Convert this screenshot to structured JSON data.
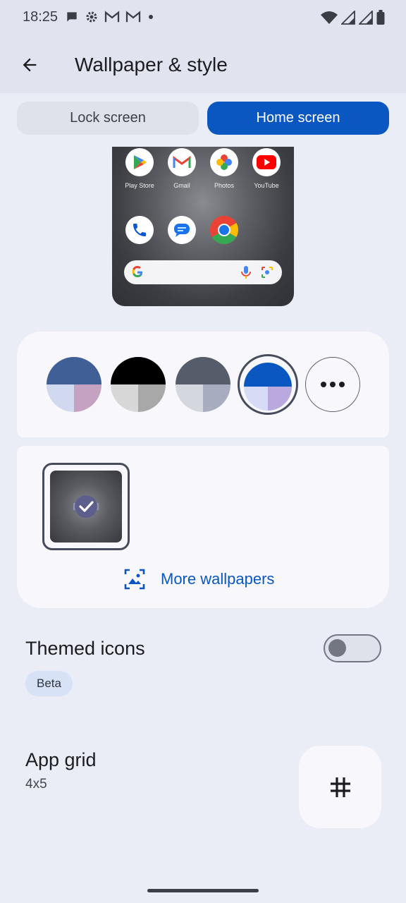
{
  "status_bar": {
    "time": "18:25",
    "left_icons": [
      "chat-icon",
      "gear-icon",
      "gmail-icon",
      "gmail-icon",
      "dot-icon"
    ],
    "right_icons": [
      "wifi-icon",
      "signal-icon",
      "signal-icon",
      "battery-icon"
    ]
  },
  "app_bar": {
    "title": "Wallpaper & style",
    "back_icon": "arrow-back-icon"
  },
  "tabs": [
    {
      "label": "Lock screen",
      "selected": false
    },
    {
      "label": "Home screen",
      "selected": true
    }
  ],
  "preview": {
    "apps_row1": [
      {
        "label": "Play Store",
        "icon": "play-store-icon"
      },
      {
        "label": "Gmail",
        "icon": "gmail-icon"
      },
      {
        "label": "Photos",
        "icon": "photos-icon"
      },
      {
        "label": "YouTube",
        "icon": "youtube-icon"
      }
    ],
    "apps_row2": [
      {
        "icon": "phone-icon"
      },
      {
        "icon": "messages-icon"
      },
      {
        "icon": "chrome-icon"
      }
    ],
    "search_icons": [
      "google-g-icon",
      "mic-icon",
      "lens-icon"
    ]
  },
  "color_options": [
    {
      "top": "#3f5f96",
      "bottom_left": "#d0d9ef",
      "bottom_right": "#c6a2c2",
      "selected": false
    },
    {
      "top": "#000000",
      "bottom_left": "#d7d7d7",
      "bottom_right": "#a8a8a8",
      "selected": false
    },
    {
      "top": "#565d6a",
      "bottom_left": "#d4d7de",
      "bottom_right": "#a7adbe",
      "selected": false
    },
    {
      "top": "#0b57c1",
      "bottom_left": "#d6dcf6",
      "bottom_right": "#b9a9de",
      "selected": true
    }
  ],
  "more_colors_icon": "more-horiz-icon",
  "wallpaper": {
    "more_label": "More wallpapers",
    "more_icon": "image-search-icon",
    "selected_icon": "check-circle-icon"
  },
  "themed_icons": {
    "title": "Themed icons",
    "badge": "Beta",
    "enabled": false
  },
  "app_grid": {
    "title": "App grid",
    "value": "4x5",
    "icon": "grid-hash-icon"
  },
  "colors": {
    "accent": "#0b57c1",
    "background": "#eaedf6",
    "panel": "#f7f7fc"
  }
}
